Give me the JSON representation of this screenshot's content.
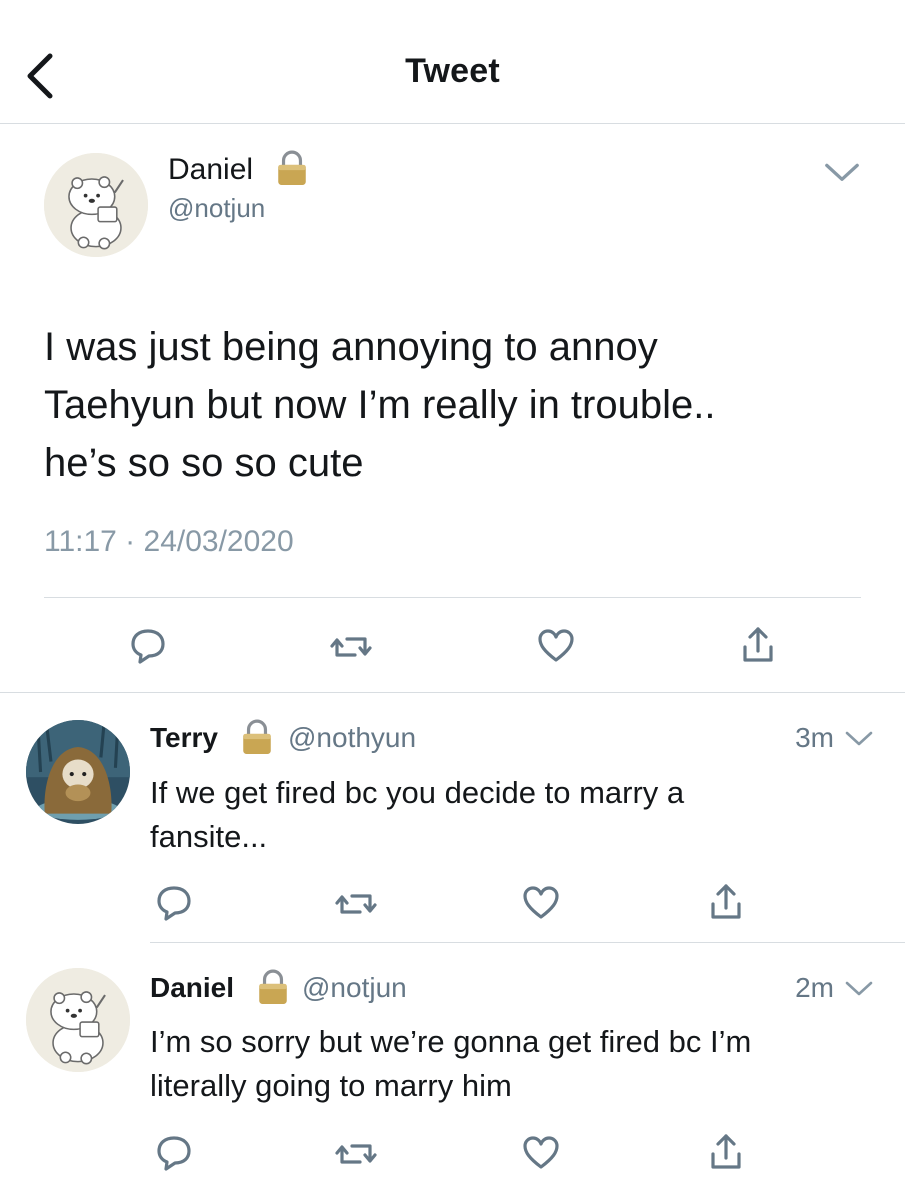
{
  "header": {
    "title": "Tweet"
  },
  "main_tweet": {
    "name": "Daniel",
    "handle": "@notjun",
    "text_lines": [
      "I was just being annoying to annoy",
      "Taehyun but now I’m really in trouble..",
      "he’s so so so cute"
    ],
    "timestamp": "11:17 · 24/03/2020"
  },
  "replies": [
    {
      "name": "Terry",
      "handle": "@nothyun",
      "time": "3m",
      "text_lines": [
        "If we get fired bc you decide to marry a",
        "fansite..."
      ]
    },
    {
      "name": "Daniel",
      "handle": "@notjun",
      "time": "2m",
      "text_lines": [
        "I’m so sorry but we’re gonna get fired bc I’m",
        "literally going to marry him"
      ]
    }
  ],
  "icons": [
    "back-chevron-icon",
    "lock-icon",
    "chevron-down-icon",
    "reply-icon",
    "retweet-icon",
    "like-icon",
    "share-icon"
  ],
  "colors": {
    "text": "#14171a",
    "secondary": "#657786",
    "icon": "#657786",
    "separator": "#d8dde1",
    "lock": "#c9a653"
  }
}
